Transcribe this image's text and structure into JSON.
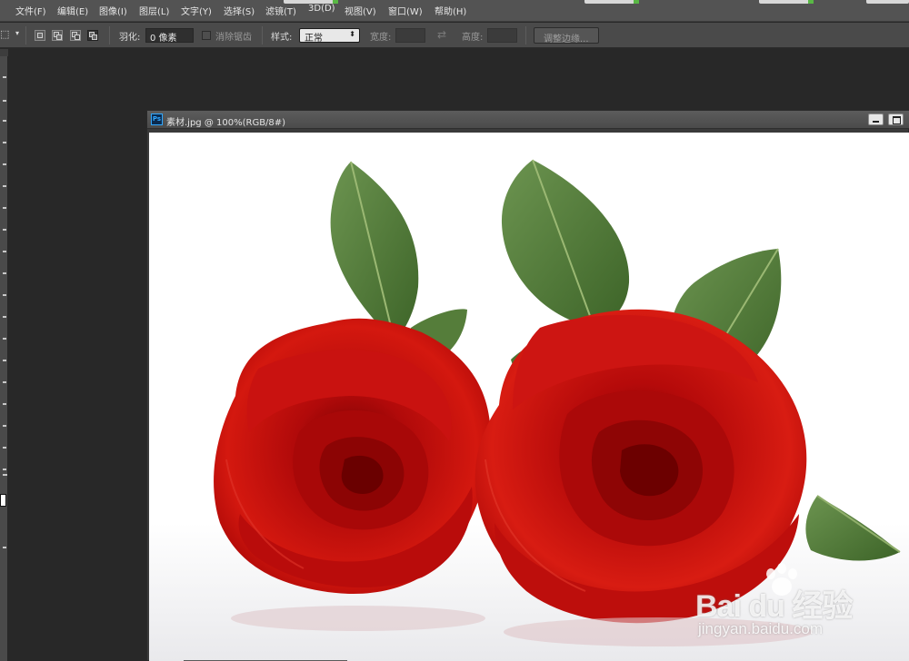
{
  "menubar": {
    "items": [
      {
        "label": "文件(F)"
      },
      {
        "label": "编辑(E)"
      },
      {
        "label": "图像(I)"
      },
      {
        "label": "图层(L)"
      },
      {
        "label": "文字(Y)"
      },
      {
        "label": "选择(S)"
      },
      {
        "label": "滤镜(T)"
      },
      {
        "label": "3D(D)"
      },
      {
        "label": "视图(V)"
      },
      {
        "label": "窗口(W)"
      },
      {
        "label": "帮助(H)"
      }
    ]
  },
  "options": {
    "feather_label": "羽化:",
    "feather_value": "0 像素",
    "antialias_label": "消除锯齿",
    "style_label": "样式:",
    "style_value": "正常",
    "width_label": "宽度:",
    "height_label": "高度:",
    "refine_edge_label": "调整边缘..."
  },
  "document": {
    "app_icon": "Ps",
    "title": "素材.jpg @ 100%(RGB/8#)",
    "image_subject": "two red roses with green leaves on white background"
  },
  "watermark": {
    "line1": "Bai du 经验",
    "line2": "jingyan.baidu.com"
  },
  "colors": {
    "ui_dark": "#282828",
    "menubar": "#535353",
    "optionsbar": "#4a4a4a",
    "rose_red": "#c80f0f",
    "leaf_green": "#4f7a34"
  }
}
